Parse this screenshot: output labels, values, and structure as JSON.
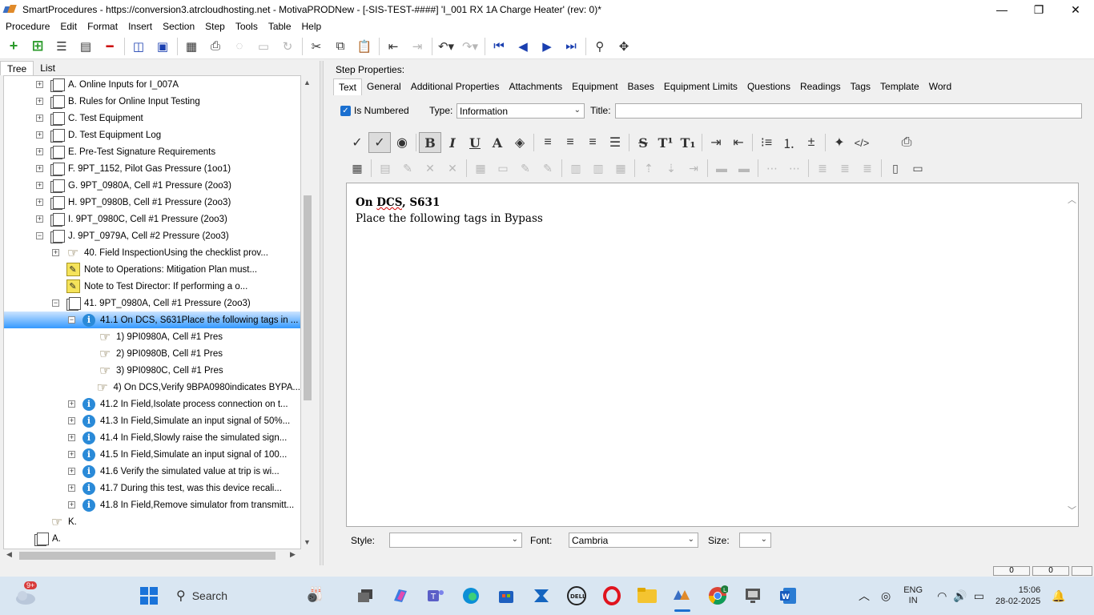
{
  "window": {
    "title": "SmartProcedures - https://conversion3.atrcloudhosting.net - MotivaPRODNew - [-SIS-TEST-####] 'I_001 RX 1A Charge Heater' (rev: 0)*",
    "minimize": "—",
    "maximize": "❐",
    "close": "✕"
  },
  "menu": [
    "Procedure",
    "Edit",
    "Format",
    "Insert",
    "Section",
    "Step",
    "Tools",
    "Table",
    "Help"
  ],
  "left_tabs": [
    "Tree",
    "List"
  ],
  "tree": [
    {
      "label": "A. Online Inputs for I_007A",
      "icon": "section-icon",
      "expander": "+"
    },
    {
      "label": "B. Rules for Online Input Testing",
      "icon": "section-icon",
      "expander": "+"
    },
    {
      "label": "C. Test Equipment",
      "icon": "section-icon",
      "expander": "+"
    },
    {
      "label": "D. Test Equipment Log",
      "icon": "section-icon",
      "expander": "+"
    },
    {
      "label": "E. Pre-Test Signature Requirements",
      "icon": "section-icon",
      "expander": "+"
    },
    {
      "label": "F. 9PT_1152, Pilot Gas Pressure (1oo1)",
      "icon": "section-icon",
      "expander": "+"
    },
    {
      "label": "G. 9PT_0980A, Cell #1 Pressure (2oo3)",
      "icon": "section-icon",
      "expander": "+"
    },
    {
      "label": "H. 9PT_0980B, Cell #1 Pressure (2oo3)",
      "icon": "section-icon",
      "expander": "+"
    },
    {
      "label": "I. 9PT_0980C, Cell #1 Pressure (2oo3)",
      "icon": "section-icon",
      "expander": "+"
    },
    {
      "label": "J. 9PT_0979A, Cell #2 Pressure (2oo3)",
      "icon": "section-icon",
      "expander": "−"
    },
    {
      "label": "40. Field InspectionUsing the checklist prov...",
      "icon": "hand-icon",
      "expander": "+"
    },
    {
      "label": "Note to Operations: Mitigation Plan must...",
      "icon": "note-icon",
      "expander": ""
    },
    {
      "label": "Note to Test Director: If performing a o...",
      "icon": "note-icon",
      "expander": ""
    },
    {
      "label": "41. 9PT_0980A, Cell #1 Pressure (2oo3)",
      "icon": "section-icon",
      "expander": "−"
    },
    {
      "label": "41.1 On DCS, S631Place the following tags in ...",
      "icon": "info-icon",
      "expander": "−",
      "selected": true
    },
    {
      "label": "1) 9PI0980A, Cell #1 Pres",
      "icon": "hand-icon",
      "expander": ""
    },
    {
      "label": "2) 9PI0980B, Cell #1 Pres",
      "icon": "hand-icon",
      "expander": ""
    },
    {
      "label": "3) 9PI0980C, Cell #1 Pres",
      "icon": "hand-icon",
      "expander": ""
    },
    {
      "label": "4) On DCS,Verify 9BPA0980indicates BYPA...",
      "icon": "hand-icon",
      "expander": ""
    },
    {
      "label": "41.2 In Field,Isolate process connection on t...",
      "icon": "info-icon",
      "expander": "+"
    },
    {
      "label": "41.3 In Field,Simulate an input signal of 50%...",
      "icon": "info-icon",
      "expander": "+"
    },
    {
      "label": "41.4 In Field,Slowly raise the simulated sign...",
      "icon": "info-icon",
      "expander": "+"
    },
    {
      "label": "41.5 In Field,Simulate an input signal of 100...",
      "icon": "info-icon",
      "expander": "+"
    },
    {
      "label": "41.6 Verify the simulated value at trip is wi...",
      "icon": "info-icon",
      "expander": "+"
    },
    {
      "label": "41.7 During this test, was this device recali...",
      "icon": "info-icon",
      "expander": "+"
    },
    {
      "label": "41.8 In Field,Remove simulator from transmitt...",
      "icon": "info-icon",
      "expander": "+"
    },
    {
      "label": "K.",
      "icon": "hand-icon",
      "expander": ""
    },
    {
      "label": "A.",
      "icon": "section-icon",
      "expander": ""
    }
  ],
  "step_properties": {
    "heading": "Step Properties:",
    "tabs": [
      "Text",
      "General",
      "Additional Properties",
      "Attachments",
      "Equipment",
      "Bases",
      "Equipment Limits",
      "Questions",
      "Readings",
      "Tags",
      "Template",
      "Word"
    ],
    "is_numbered_label": "Is Numbered",
    "type_label": "Type:",
    "type_value": "Information",
    "title_label": "Title:",
    "title_value": ""
  },
  "editor": {
    "line1_prefix": "On ",
    "line1_misspelled": "DCS",
    "line1_suffix": ", S631",
    "line2": "Place the following tags in Bypass"
  },
  "bottom_fields": {
    "style_label": "Style:",
    "style_value": "",
    "font_label": "Font:",
    "font_value": "Cambria",
    "size_label": "Size:",
    "size_value": ""
  },
  "status": {
    "cell1": "0",
    "cell2": "0"
  },
  "taskbar": {
    "widget_badge": "9+",
    "search_label": "Search",
    "lang_line1": "ENG",
    "lang_line2": "IN",
    "time": "15:06",
    "date": "28-02-2025"
  },
  "colors": {
    "selection": "#3399ff",
    "accent": "#1a6fd0",
    "taskbar": "#d9e6f2"
  }
}
